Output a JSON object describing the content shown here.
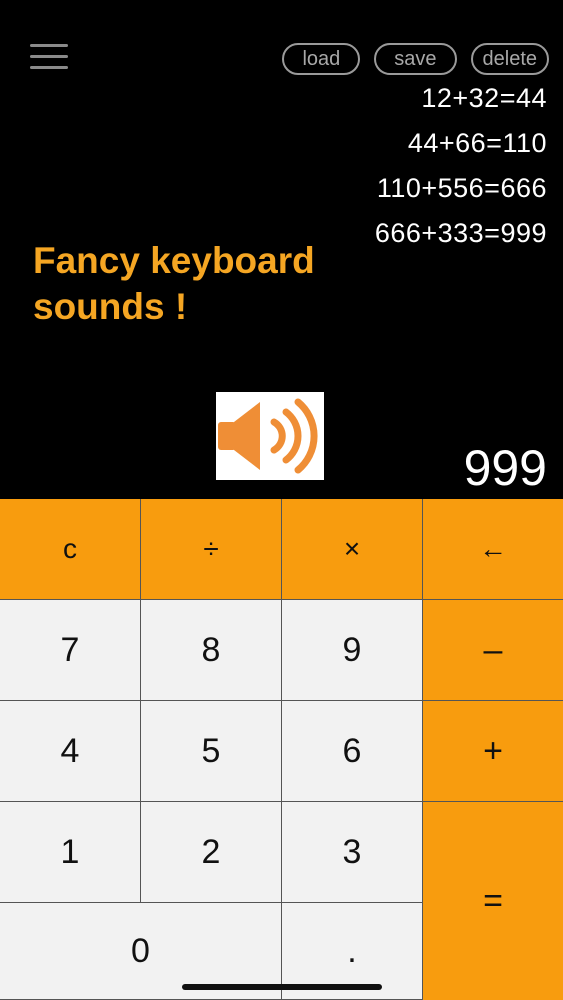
{
  "top_bar": {
    "menu_icon": "hamburger-menu-icon",
    "load_label": "load",
    "save_label": "save",
    "delete_label": "delete"
  },
  "history": [
    "12+32=44",
    "44+66=110",
    "110+556=666",
    "666+333=999"
  ],
  "promo_text": "Fancy keyboard sounds !",
  "sound_icon": "speaker-volume-icon",
  "display": {
    "value": "999"
  },
  "keypad": {
    "clear": "c",
    "divide": "÷",
    "multiply": "×",
    "backspace": "←",
    "seven": "7",
    "eight": "8",
    "nine": "9",
    "minus": "–",
    "four": "4",
    "five": "5",
    "six": "6",
    "plus": "+",
    "one": "1",
    "two": "2",
    "three": "3",
    "equals": "=",
    "zero": "0",
    "dot": "."
  },
  "colors": {
    "accent": "#f89c0e",
    "promo": "#f5a623",
    "number_key": "#f2f2f2",
    "background": "#000000"
  }
}
